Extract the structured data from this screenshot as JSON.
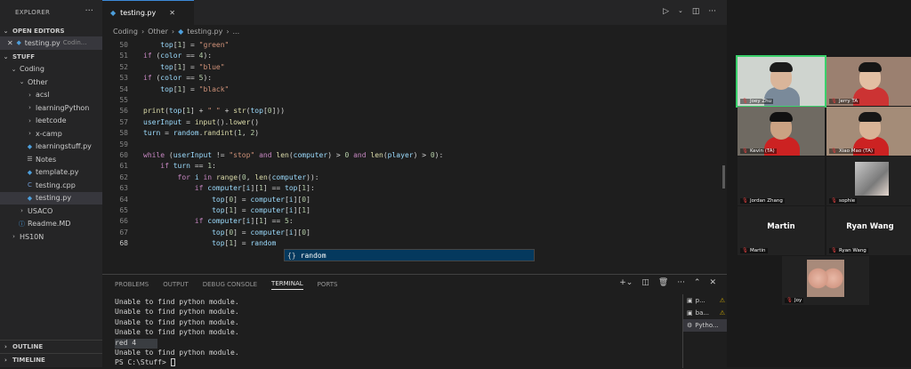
{
  "explorer": {
    "title": "EXPLORER",
    "menu": "···",
    "open_editors_label": "OPEN EDITORS",
    "open_file": "testing.py",
    "open_file_path": "Codin...",
    "folder": "STUFF",
    "tree": [
      {
        "label": "Coding",
        "depth": 1,
        "type": "folder-open"
      },
      {
        "label": "Other",
        "depth": 2,
        "type": "folder-open"
      },
      {
        "label": "acsl",
        "depth": 3,
        "type": "folder"
      },
      {
        "label": "learningPython",
        "depth": 3,
        "type": "folder"
      },
      {
        "label": "leetcode",
        "depth": 3,
        "type": "folder"
      },
      {
        "label": "x-camp",
        "depth": 3,
        "type": "folder"
      },
      {
        "label": "learningstuff.py",
        "depth": 3,
        "type": "py"
      },
      {
        "label": "Notes",
        "depth": 3,
        "type": "note"
      },
      {
        "label": "template.py",
        "depth": 3,
        "type": "py"
      },
      {
        "label": "testing.cpp",
        "depth": 3,
        "type": "cpp"
      },
      {
        "label": "testing.py",
        "depth": 3,
        "type": "py",
        "selected": true
      },
      {
        "label": "USACO",
        "depth": 2,
        "type": "folder"
      },
      {
        "label": "Readme.MD",
        "depth": 2,
        "type": "md"
      },
      {
        "label": "HS10N",
        "depth": 1,
        "type": "folder"
      }
    ],
    "outline": "OUTLINE",
    "timeline": "TIMELINE"
  },
  "editor": {
    "tab": "testing.py",
    "breadcrumb": [
      "Coding",
      "Other",
      "testing.py",
      "..."
    ],
    "lines": [
      {
        "n": "50",
        "t": "        top[1] = \"green\""
      },
      {
        "n": "51",
        "t": "    if (color == 4):"
      },
      {
        "n": "52",
        "t": "        top[1] = \"blue\""
      },
      {
        "n": "53",
        "t": "    if (color == 5):"
      },
      {
        "n": "54",
        "t": "        top[1] = \"black\""
      },
      {
        "n": "55",
        "t": ""
      },
      {
        "n": "56",
        "t": "    print(top[1] + \" \" + str(top[0]))"
      },
      {
        "n": "57",
        "t": "    userInput = input().lower()"
      },
      {
        "n": "58",
        "t": "    turn = random.randint(1, 2)"
      },
      {
        "n": "59",
        "t": ""
      },
      {
        "n": "60",
        "t": "    while (userInput != \"stop\" and len(computer) > 0 and len(player) > 0):"
      },
      {
        "n": "61",
        "t": "        if turn == 1:"
      },
      {
        "n": "62",
        "t": "            for i in range(0, len(computer)):"
      },
      {
        "n": "63",
        "t": "                if computer[i][1] == top[1]:"
      },
      {
        "n": "64",
        "t": "                    top[0] = computer[i][0]"
      },
      {
        "n": "65",
        "t": "                    top[1] = computer[i][1]"
      },
      {
        "n": "66",
        "t": "                if computer[i][1] == 5:"
      },
      {
        "n": "67",
        "t": "                    top[0] = computer[i][0]"
      },
      {
        "n": "68",
        "t": "                    top[1] = random"
      }
    ],
    "suggestion": "random",
    "suggestion_icon": "{}"
  },
  "panel": {
    "tabs": [
      "PROBLEMS",
      "OUTPUT",
      "DEBUG CONSOLE",
      "TERMINAL",
      "PORTS"
    ],
    "active_tab": "TERMINAL",
    "terminal_lines": [
      "Unable to find python module.",
      "Unable to find python module.",
      "Unable to find python module.",
      "Unable to find python module.",
      "red 4",
      "Unable to find python module.",
      "PS C:\\Stuff> "
    ],
    "terminals": [
      {
        "label": "p...",
        "warn": "⚠"
      },
      {
        "label": "ba...",
        "warn": "⚠"
      },
      {
        "label": "Pytho...",
        "warn": ""
      }
    ]
  },
  "zoom": {
    "participants": [
      {
        "name": "Joey Zhu",
        "kind": "video",
        "skin": "#d9b59a",
        "hair": "#1b1b1b",
        "shirt": "#7a8a9a",
        "bg": "#cfd4cf",
        "speaking": true
      },
      {
        "name": "Jerry TA",
        "kind": "video",
        "skin": "#e2bfa3",
        "hair": "#151515",
        "shirt": "#c33",
        "bg": "#9b8070"
      },
      {
        "name": "Kevin (TA)",
        "kind": "video",
        "skin": "#caa283",
        "hair": "#111",
        "shirt": "#c22",
        "bg": "#6f6a62"
      },
      {
        "name": "Xiao Mao (TA)",
        "kind": "video",
        "skin": "#d8b396",
        "hair": "#161616",
        "shirt": "#c22",
        "bg": "#a48c78"
      },
      {
        "name": "Jordan Zhang",
        "kind": "name"
      },
      {
        "name": "sophie",
        "kind": "avatar"
      },
      {
        "name": "Martin",
        "kind": "name",
        "big": "Martin"
      },
      {
        "name": "Ryan Wang",
        "kind": "name",
        "big": "Ryan Wang"
      },
      {
        "name": "Joy",
        "kind": "avatar2"
      }
    ]
  },
  "colors": {
    "accent": "#3c8ad8",
    "speaking": "#3ad06b",
    "selection": "#04395e"
  }
}
